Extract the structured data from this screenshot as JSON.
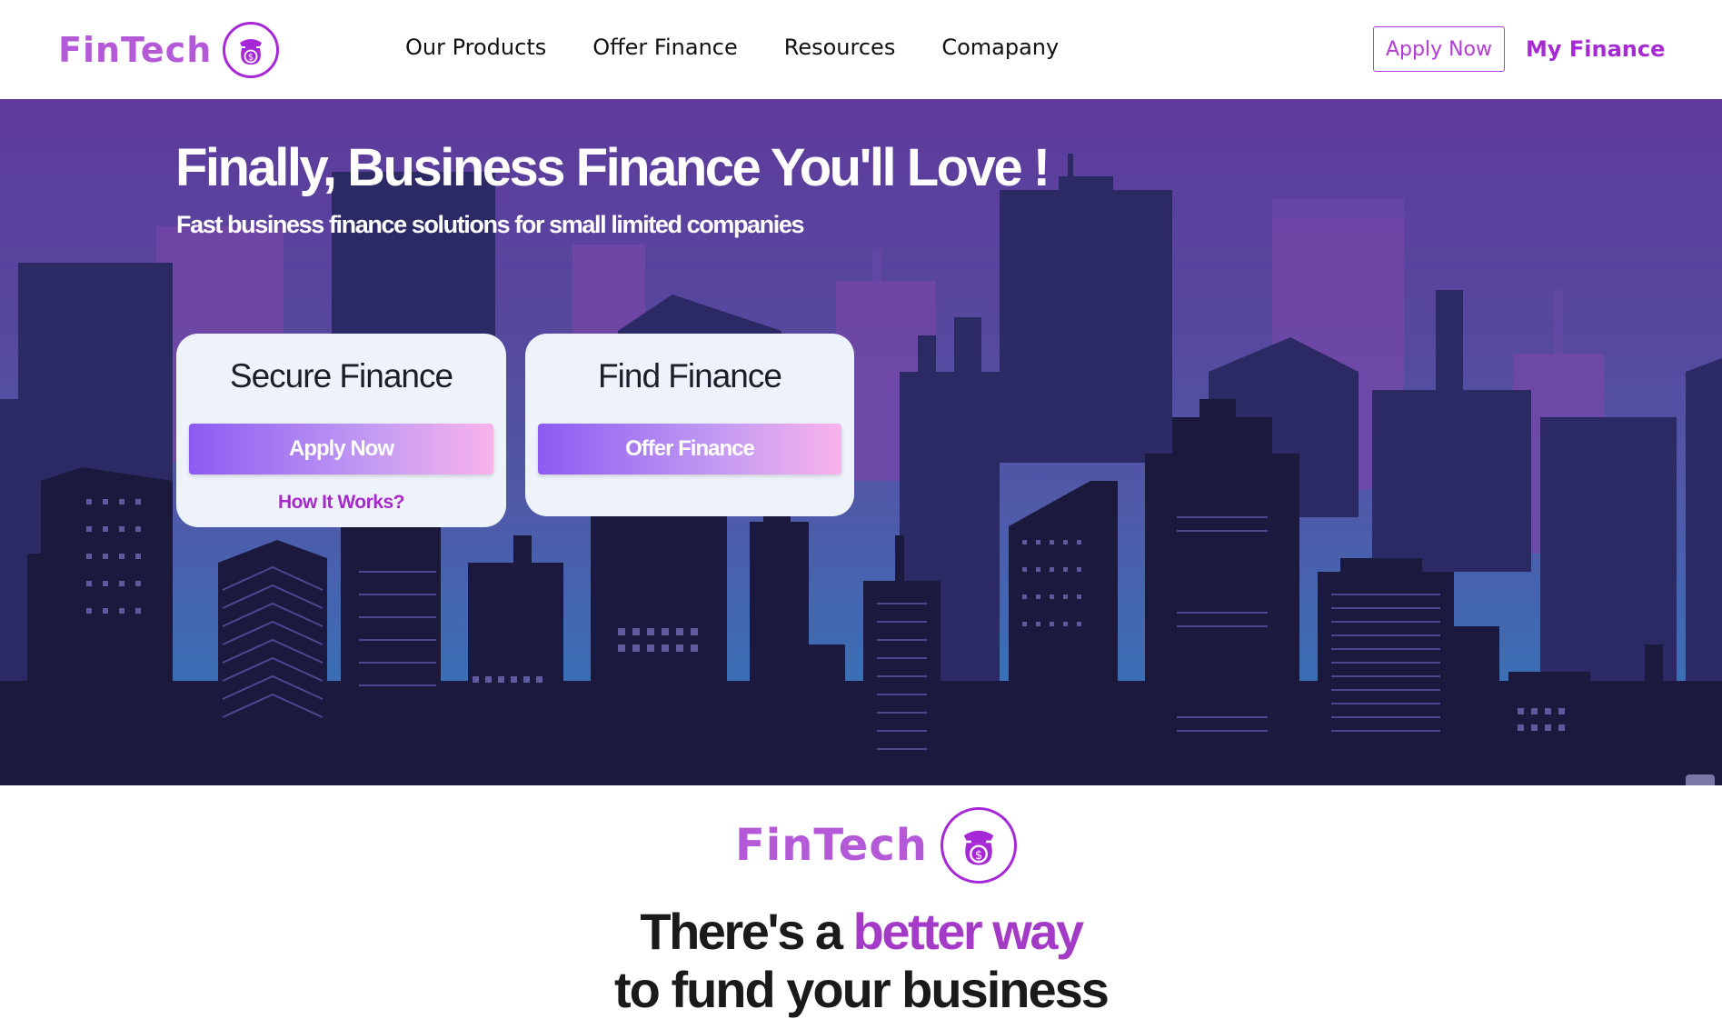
{
  "brand": {
    "name": "FinTech",
    "accent": "#a62bd3",
    "badge_icon": "money-bag-icon"
  },
  "nav": {
    "links": [
      "Our Products",
      "Offer Finance",
      "Resources",
      "Comapany"
    ],
    "apply_label": "Apply Now",
    "my_finance_label": "My Finance"
  },
  "hero": {
    "title": "Finally, Business Finance You'll Love !",
    "subtitle": "Fast business finance solutions for small limited companies",
    "cards": [
      {
        "title": "Secure Finance",
        "button": "Apply Now",
        "link": "How It Works?"
      },
      {
        "title": "Find Finance",
        "button": "Offer Finance"
      }
    ],
    "floating_icon": "><",
    "colors": {
      "sky_top": "#5e3a9c",
      "sky_bottom": "#2f8ccf",
      "buildings": "#1b1a3e"
    }
  },
  "section": {
    "tagline_prefix": "There's a",
    "tagline_accent": "better way",
    "tagline_line2": "to fund your business"
  }
}
